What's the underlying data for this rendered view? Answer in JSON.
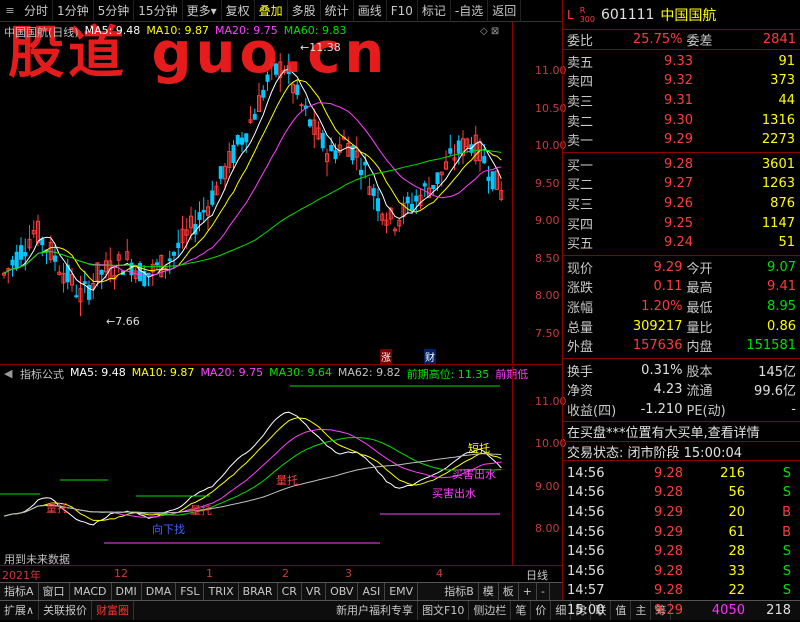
{
  "toolbar": {
    "items": [
      "分时",
      "1分钟",
      "5分钟",
      "15分钟",
      "更多",
      "复权",
      "叠加",
      "多股",
      "统计",
      "画线",
      "F10",
      "标记",
      "-自选",
      "返回"
    ],
    "active": "叠加"
  },
  "watermark": "股道 guo.cn",
  "main_title": {
    "name": "中国国航(日线)",
    "ma5": "MA5: 9.48",
    "ma10": "MA10: 9.87",
    "ma20": "MA20: 9.75",
    "ma60": "MA60: 9.83"
  },
  "price_ticks": [
    "11.00",
    "10.50",
    "10.00",
    "9.50",
    "9.00",
    "8.50",
    "8.00",
    "7.50"
  ],
  "annotations": {
    "high": "11.38",
    "low": "7.66",
    "zhang": "涨",
    "cai": "财"
  },
  "ind_title": {
    "name": "指标公式",
    "ma5": "MA5: 9.48",
    "ma10": "MA10: 9.87",
    "ma20": "MA20: 9.75",
    "ma30": "MA30: 9.64",
    "ma62": "MA62: 9.82",
    "prev_high": "前期高位: 11.35",
    "prev_low": "前期低"
  },
  "ind_ticks": [
    "11.00",
    "10.00",
    "9.00",
    "8.00"
  ],
  "ind_labels": {
    "l1": "量托",
    "l2": "向下找",
    "l3": "量托",
    "l4": "量托",
    "l5": "真托",
    "l6": "买害出水",
    "l7": "买害出水",
    "l8": "短托",
    "future": "用到未来数据"
  },
  "date_axis": {
    "year": "2021年",
    "m12": "12",
    "m1": "1",
    "m2": "2",
    "m3": "3",
    "m4": "4",
    "right": "日线"
  },
  "tabs": [
    "指标A",
    "窗口",
    "MACD",
    "DMI",
    "DMA",
    "FSL",
    "TRIX",
    "BRAR",
    "CR",
    "VR",
    "OBV",
    "ASI",
    "EMV",
    "指标B",
    "模",
    "板"
  ],
  "bottom": [
    "扩展∧",
    "关联报价",
    "财富圈",
    "新用户福利专享",
    "图文F10",
    "侧边栏",
    "笔",
    "价",
    "细",
    "势",
    "联",
    "值",
    "主",
    "筹"
  ],
  "stock": {
    "mark_l": "L",
    "mark_r": "R",
    "mark_300": "300",
    "code": "601111",
    "name": "中国国航"
  },
  "weibi": {
    "l1": "委比",
    "v1": "25.75%",
    "l2": "委差",
    "v2": "2841"
  },
  "asks": [
    {
      "label": "卖五",
      "price": "9.33",
      "vol": "91"
    },
    {
      "label": "卖四",
      "price": "9.32",
      "vol": "373"
    },
    {
      "label": "卖三",
      "price": "9.31",
      "vol": "44"
    },
    {
      "label": "卖二",
      "price": "9.30",
      "vol": "1316"
    },
    {
      "label": "卖一",
      "price": "9.29",
      "vol": "2273"
    }
  ],
  "bids": [
    {
      "label": "买一",
      "price": "9.28",
      "vol": "3601"
    },
    {
      "label": "买二",
      "price": "9.27",
      "vol": "1263"
    },
    {
      "label": "买三",
      "price": "9.26",
      "vol": "876"
    },
    {
      "label": "买四",
      "price": "9.25",
      "vol": "1147"
    },
    {
      "label": "买五",
      "price": "9.24",
      "vol": "51"
    }
  ],
  "quote": [
    {
      "l1": "现价",
      "v1": "9.29",
      "c1": "red",
      "l2": "今开",
      "v2": "9.07",
      "c2": "green"
    },
    {
      "l1": "涨跌",
      "v1": "0.11",
      "c1": "red",
      "l2": "最高",
      "v2": "9.41",
      "c2": "red"
    },
    {
      "l1": "涨幅",
      "v1": "1.20%",
      "c1": "red",
      "l2": "最低",
      "v2": "8.95",
      "c2": "green"
    },
    {
      "l1": "总量",
      "v1": "309217",
      "c1": "yellow",
      "l2": "量比",
      "v2": "0.86",
      "c2": "yellow"
    },
    {
      "l1": "外盘",
      "v1": "157636",
      "c1": "red",
      "l2": "内盘",
      "v2": "151581",
      "c2": "green"
    }
  ],
  "stats": [
    {
      "l1": "换手",
      "v1": "0.31%",
      "l2": "股本",
      "v2": "145亿"
    },
    {
      "l1": "净资",
      "v1": "4.23",
      "l2": "流通",
      "v2": "99.6亿"
    },
    {
      "l1": "收益(四)",
      "v1": "-1.210",
      "l2": "PE(动)",
      "v2": "-"
    }
  ],
  "notice": "在买盘***位置有大买单,查看详情",
  "trade_state": "交易状态: 闭市阶段 15:00:04",
  "ticks": [
    {
      "t": "14:56",
      "p": "9.28",
      "v": "216",
      "f": "S"
    },
    {
      "t": "14:56",
      "p": "9.28",
      "v": "56",
      "f": "S"
    },
    {
      "t": "14:56",
      "p": "9.29",
      "v": "20",
      "f": "B"
    },
    {
      "t": "14:56",
      "p": "9.29",
      "v": "61",
      "f": "B"
    },
    {
      "t": "14:56",
      "p": "9.28",
      "v": "28",
      "f": "S"
    },
    {
      "t": "14:56",
      "p": "9.28",
      "v": "33",
      "f": "S"
    },
    {
      "t": "14:57",
      "p": "9.28",
      "v": "22",
      "f": "S"
    },
    {
      "t": "15:00",
      "p": "9.29",
      "v": "4050",
      "f": "218"
    }
  ]
}
